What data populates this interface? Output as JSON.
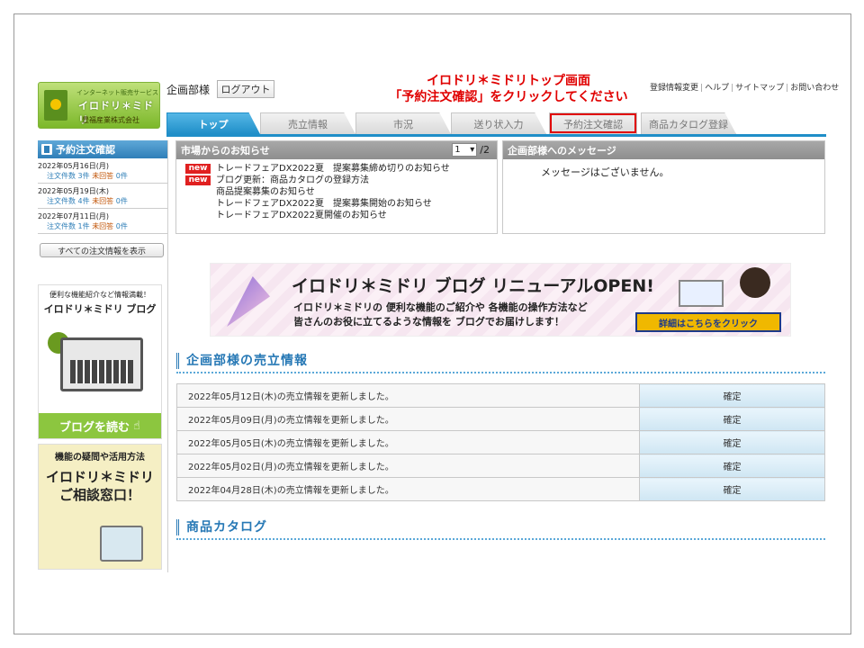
{
  "header": {
    "logo_tagline": "インターネット販売サービス",
    "logo_name": "イロドリ＊ミドリ",
    "logo_company": "豊福産業株式会社",
    "company_label": "企画部様",
    "logout_label": "ログアウト",
    "instruction_line1": "イロドリ＊ミドリトップ画面",
    "instruction_line2": "「予約注文確認」をクリックしてください",
    "links": [
      "登録情報変更",
      "ヘルプ",
      "サイトマップ",
      "お問い合わせ"
    ]
  },
  "tabs": [
    {
      "label": "トップ"
    },
    {
      "label": "売立情報"
    },
    {
      "label": "市況"
    },
    {
      "label": "送り状入力"
    },
    {
      "label": "予約注文確認"
    },
    {
      "label": "商品カタログ登録"
    }
  ],
  "sidebar": {
    "title": "予約注文確認",
    "dates": [
      {
        "date": "2022年05月16日(月)",
        "count_label": "注文件数",
        "count": "3件",
        "unanswered_label": "未回答",
        "unanswered": "0件"
      },
      {
        "date": "2022年05月19日(木)",
        "count_label": "注文件数",
        "count": "4件",
        "unanswered_label": "未回答",
        "unanswered": "0件"
      },
      {
        "date": "2022年07月11日(月)",
        "count_label": "注文件数",
        "count": "1件",
        "unanswered_label": "未回答",
        "unanswered": "0件"
      }
    ],
    "all_orders_label": "すべての注文情報を表示",
    "banner1": {
      "line1": "便利な機能紹介など情報満載！",
      "line2": "イロドリ＊ミドリ ブログ",
      "button": "ブログを読む"
    },
    "banner2": {
      "line1": "機能の疑問や活用方法",
      "line2": "イロドリ＊ミドリ",
      "line3": "ご相談窓口！"
    }
  },
  "news": {
    "title": "市場からのお知らせ",
    "page": "1",
    "total": "/2",
    "items": [
      {
        "badge": "new",
        "text": "トレードフェアDX2022夏　提案募集締め切りのお知らせ"
      },
      {
        "badge": "new",
        "text": "ブログ更新：商品カタログの登録方法"
      },
      {
        "badge": "",
        "text": "商品提案募集のお知らせ"
      },
      {
        "badge": "",
        "text": "トレードフェアDX2022夏　提案募集開始のお知らせ"
      },
      {
        "badge": "",
        "text": "トレードフェアDX2022夏開催のお知らせ"
      }
    ]
  },
  "messages": {
    "title": "企画部様へのメッセージ",
    "text": "メッセージはございません。"
  },
  "hero": {
    "headline": "イロドリ＊ミドリ ブログ リニューアルOPEN!",
    "line1": "イロドリ＊ミドリの 便利な機能のご紹介や 各機能の操作方法など",
    "line2": "皆さんのお役に立てるような情報を ブログでお届けします！",
    "cta": "詳細はこちらをクリック"
  },
  "sales": {
    "title": "企画部様の売立情報",
    "rows": [
      {
        "text": "2022年05月12日(木)の売立情報を更新しました。",
        "action": "確定"
      },
      {
        "text": "2022年05月09日(月)の売立情報を更新しました。",
        "action": "確定"
      },
      {
        "text": "2022年05月05日(木)の売立情報を更新しました。",
        "action": "確定"
      },
      {
        "text": "2022年05月02日(月)の売立情報を更新しました。",
        "action": "確定"
      },
      {
        "text": "2022年04月28日(木)の売立情報を更新しました。",
        "action": "確定"
      }
    ]
  },
  "catalog": {
    "title": "商品カタログ"
  },
  "colors": {
    "accent": "#1f8ec8",
    "instruction": "#e00000",
    "badge": "#e02020",
    "section_title": "#2678b5"
  }
}
